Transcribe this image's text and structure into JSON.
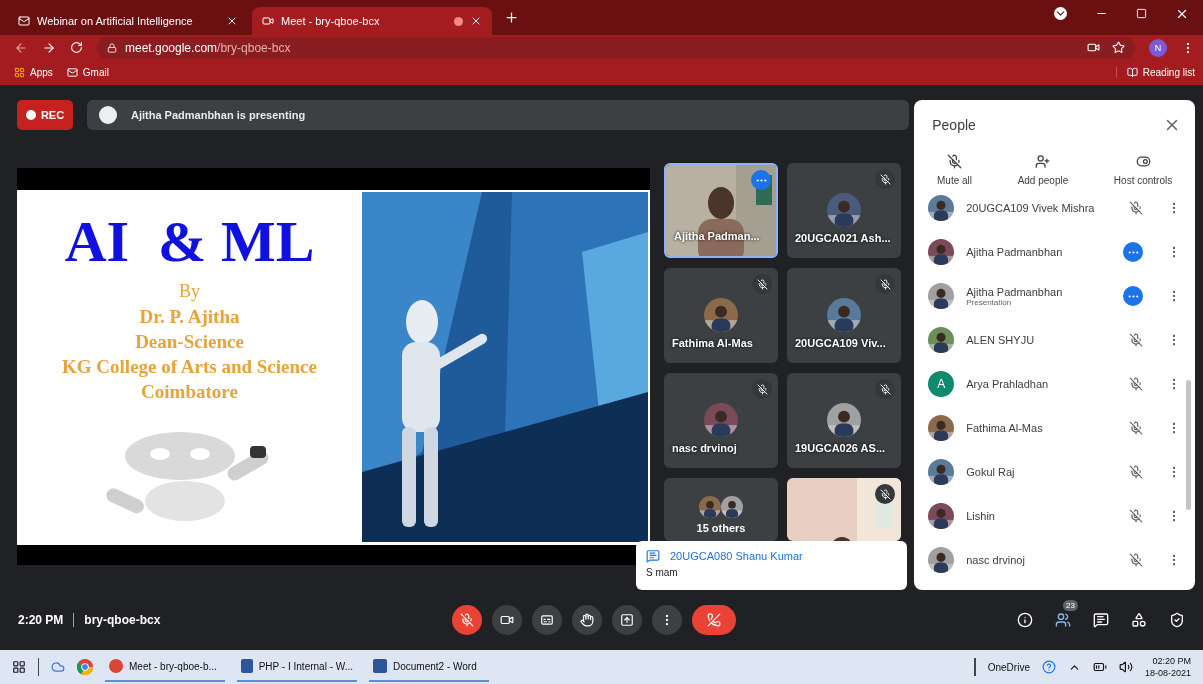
{
  "browser": {
    "tabs": [
      {
        "title": "Webinar on Artificial Intelligence",
        "selected": false,
        "recording": false
      },
      {
        "title": "Meet - bry-qboe-bcx",
        "selected": true,
        "recording": true
      }
    ],
    "address": {
      "host": "meet.google.com",
      "path": "/bry-qboe-bcx"
    },
    "profile_initial": "N",
    "bookmarks": [
      "Apps",
      "Gmail"
    ],
    "reading_list": "Reading list"
  },
  "meet": {
    "rec_label": "REC",
    "presenting": "Ajitha Padmanbhan is presenting",
    "slide": {
      "title": "AI  & ML",
      "lines": [
        "By",
        "Dr. P. Ajitha",
        "Dean-Science",
        "KG College of Arts and Science",
        "Coimbatore"
      ]
    },
    "tiles": [
      {
        "kind": "video",
        "name": "Ajitha Padman...",
        "muted": false,
        "pinned": true
      },
      {
        "kind": "avatar",
        "name": "20UGCA021 Ash...",
        "muted": true,
        "pinned": false
      },
      {
        "kind": "avatar",
        "name": "Fathima Al-Mas",
        "muted": true,
        "pinned": false
      },
      {
        "kind": "avatar",
        "name": "20UGCA109 Viv...",
        "muted": true,
        "pinned": false
      },
      {
        "kind": "avatar",
        "name": "nasc drvinoj",
        "muted": true,
        "pinned": false
      },
      {
        "kind": "avatar",
        "name": "19UGCA026 AS...",
        "muted": true,
        "pinned": false
      },
      {
        "kind": "others",
        "name": "15 others",
        "muted": false,
        "pinned": false
      },
      {
        "kind": "video",
        "muted": true,
        "pinned": false
      }
    ],
    "chat_toast": {
      "sender": "20UGCA080 Shanu Kumar",
      "message": "S mam"
    },
    "time": "2:20 PM",
    "code": "bry-qboe-bcx",
    "mic_muted": true,
    "people_count": "23"
  },
  "people_panel": {
    "title": "People",
    "actions": [
      "Mute all",
      "Add people",
      "Host controls"
    ],
    "participants": [
      {
        "name": "20UGCA109 Vivek Mishra",
        "muted": true,
        "presenting": false
      },
      {
        "name": "Ajitha Padmanbhan",
        "muted": false,
        "presenting": true
      },
      {
        "name": "Ajitha Padmanbhan",
        "subtitle": "Presentation",
        "muted": false,
        "presenting": true
      },
      {
        "name": "ALEN SHYJU",
        "muted": true,
        "presenting": false
      },
      {
        "name": "Arya Prahladhan",
        "initial": "A",
        "color": "#0f8a6e",
        "muted": true,
        "presenting": false
      },
      {
        "name": "Fathima Al-Mas",
        "muted": true,
        "presenting": false
      },
      {
        "name": "Gokul Raj",
        "muted": true,
        "presenting": false
      },
      {
        "name": "Lishin",
        "muted": true,
        "presenting": false
      },
      {
        "name": "nasc drvinoj",
        "muted": true,
        "presenting": false
      }
    ]
  },
  "taskbar": {
    "windows": [
      "Meet - bry-qboe-b...",
      "PHP - I Internal - W...",
      "Document2 - Word"
    ],
    "onedrive": "OneDrive",
    "time": "02:20 PM",
    "date": "18-08-2021"
  }
}
